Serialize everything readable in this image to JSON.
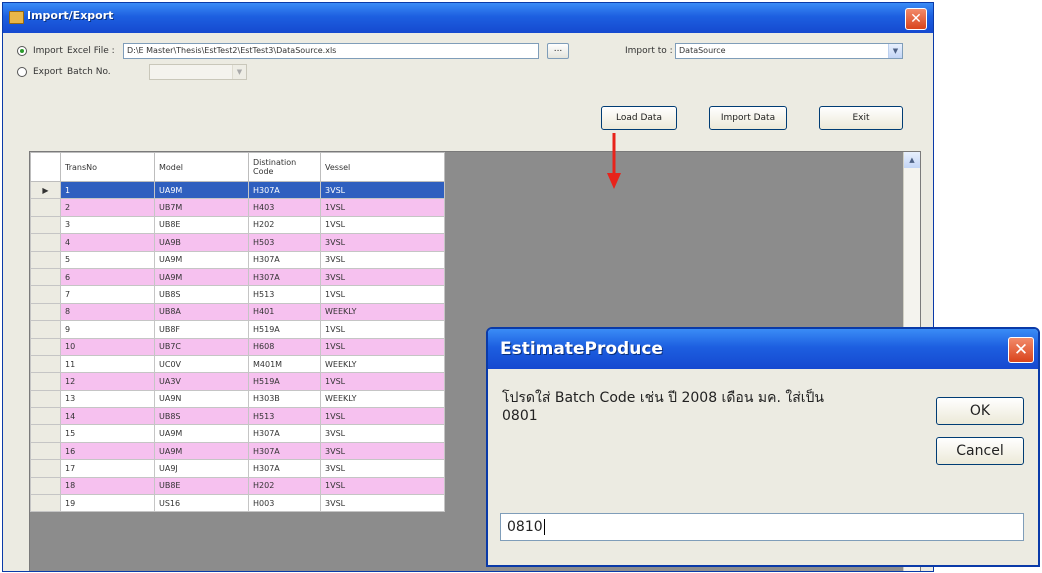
{
  "window": {
    "title": "Import/Export",
    "close_glyph": "✕"
  },
  "controls": {
    "import_label": "Import",
    "excel_file_label": "Excel File :",
    "excel_file_value": "D:\\E Master\\Thesis\\EstTest2\\EstTest3\\DataSource.xls",
    "browse_label": "...",
    "import_to_label": "Import to :",
    "import_to_value": "DataSource",
    "export_label": "Export",
    "batch_no_label": "Batch No.",
    "batch_no_value": "",
    "load_data_label": "Load Data",
    "import_data_label": "Import Data",
    "exit_label": "Exit"
  },
  "grid": {
    "columns": [
      "TransNo",
      "Model",
      "Distination Code",
      "Vessel"
    ],
    "rows": [
      [
        "1",
        "UA9M",
        "H307A",
        "3VSL"
      ],
      [
        "2",
        "UB7M",
        "H403",
        "1VSL"
      ],
      [
        "3",
        "UB8E",
        "H202",
        "1VSL"
      ],
      [
        "4",
        "UA9B",
        "H503",
        "3VSL"
      ],
      [
        "5",
        "UA9M",
        "H307A",
        "3VSL"
      ],
      [
        "6",
        "UA9M",
        "H307A",
        "3VSL"
      ],
      [
        "7",
        "UB8S",
        "H513",
        "1VSL"
      ],
      [
        "8",
        "UB8A",
        "H401",
        "WEEKLY"
      ],
      [
        "9",
        "UB8F",
        "H519A",
        "1VSL"
      ],
      [
        "10",
        "UB7C",
        "H608",
        "1VSL"
      ],
      [
        "11",
        "UC0V",
        "M401M",
        "WEEKLY"
      ],
      [
        "12",
        "UA3V",
        "H519A",
        "1VSL"
      ],
      [
        "13",
        "UA9N",
        "H303B",
        "WEEKLY"
      ],
      [
        "14",
        "UB8S",
        "H513",
        "1VSL"
      ],
      [
        "15",
        "UA9M",
        "H307A",
        "3VSL"
      ],
      [
        "16",
        "UA9M",
        "H307A",
        "3VSL"
      ],
      [
        "17",
        "UA9J",
        "H307A",
        "3VSL"
      ],
      [
        "18",
        "UB8E",
        "H202",
        "1VSL"
      ],
      [
        "19",
        "US16",
        "H003",
        "3VSL"
      ]
    ],
    "selected_row_marker": "▶"
  },
  "dialog": {
    "title": "EstimateProduce",
    "prompt_line1": "โปรดใส่ Batch Code เช่น ปี 2008 เดือน มค. ใส่เป็น",
    "prompt_line2": "0801",
    "ok_label": "OK",
    "cancel_label": "Cancel",
    "input_value": "0810"
  },
  "colors": {
    "titlebar": "#1d5fe0",
    "row_pink": "#f6c1ef",
    "selected_row": "#2f5fbf",
    "grid_empty": "#8c8c8c",
    "annotation_arrow": "#e8231b"
  }
}
